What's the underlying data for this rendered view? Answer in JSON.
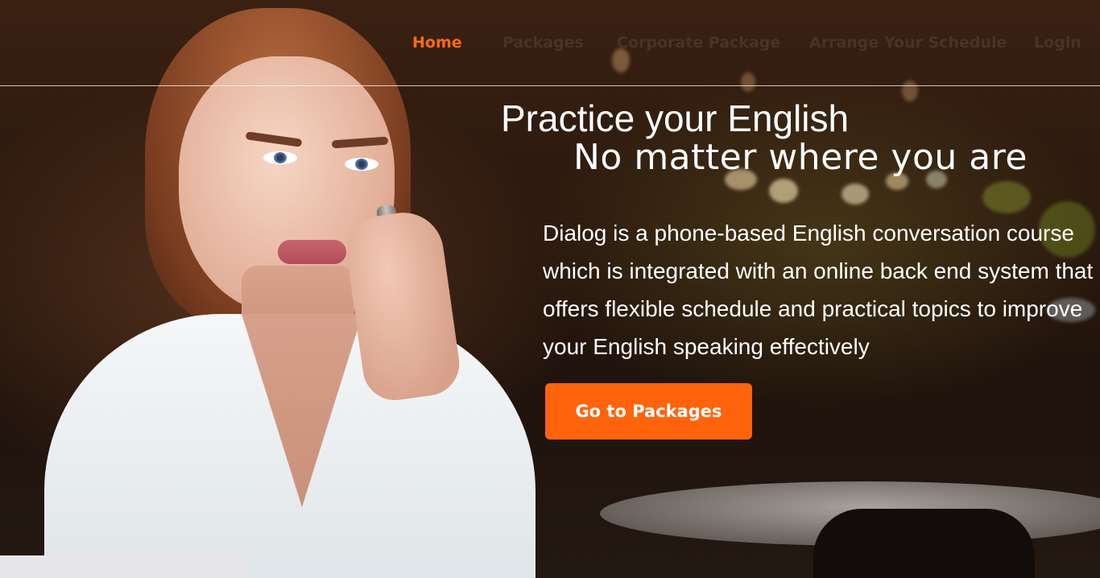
{
  "nav": {
    "items": [
      {
        "label": "Home",
        "active": true
      },
      {
        "label": "Packages",
        "active": false
      },
      {
        "label": "Corporate Package",
        "active": false
      },
      {
        "label": "Arrange Your Schedule",
        "active": false
      },
      {
        "label": "Login",
        "active": false
      }
    ]
  },
  "hero": {
    "headline_line1": "Practice your English",
    "headline_line2": "No matter where you are",
    "description": "Dialog is a phone-based English conversation course which is integrated with an online back end system that offers flexible schedule and practical topics to improve your English speaking effectively",
    "cta_label": "Go to Packages"
  },
  "colors": {
    "accent": "#ff640d",
    "nav_active": "#ff6a13",
    "nav_inactive": "#4a3326",
    "hero_text": "#ffffff"
  }
}
